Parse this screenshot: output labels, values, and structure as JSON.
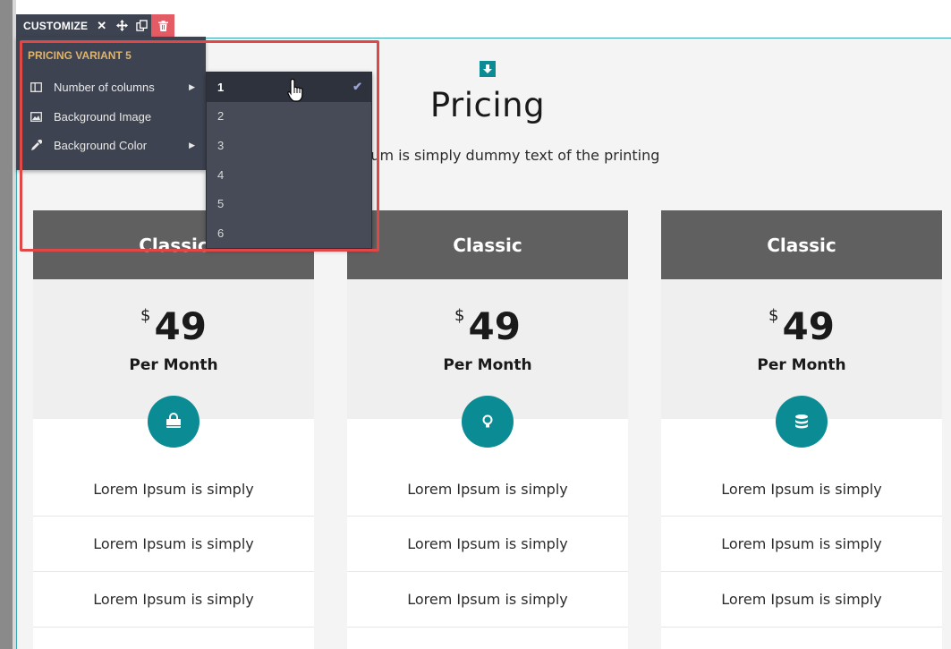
{
  "toolbar": {
    "customize_label": "CUSTOMIZE",
    "close_symbol": "✕",
    "icons": [
      "move-icon",
      "duplicate-icon",
      "trash-icon"
    ]
  },
  "menu": {
    "header": "PRICING VARIANT 5",
    "items": [
      {
        "label": "Number of columns",
        "icon": "columns-icon",
        "has_submenu": true
      },
      {
        "label": "Background Image",
        "icon": "image-icon",
        "has_submenu": false
      },
      {
        "label": "Background Color",
        "icon": "eyedropper-icon",
        "has_submenu": true
      }
    ]
  },
  "columns_submenu": {
    "options": [
      "1",
      "2",
      "3",
      "4",
      "5",
      "6"
    ],
    "selected": "1"
  },
  "section": {
    "title": "Pricing",
    "subtitle": "sum is simply dummy text of the printing"
  },
  "plans": [
    {
      "name": "Classic",
      "currency": "$",
      "price": "49",
      "period": "Per Month",
      "icon": "shopping-bag-icon",
      "features": [
        "Lorem Ipsum is simply",
        "Lorem Ipsum is simply",
        "Lorem Ipsum is simply"
      ]
    },
    {
      "name": "Classic",
      "currency": "$",
      "price": "49",
      "period": "Per Month",
      "icon": "lightbulb-icon",
      "features": [
        "Lorem Ipsum is simply",
        "Lorem Ipsum is simply",
        "Lorem Ipsum is simply"
      ]
    },
    {
      "name": "Classic",
      "currency": "$",
      "price": "49",
      "period": "Per Month",
      "icon": "database-icon",
      "features": [
        "Lorem Ipsum is simply",
        "Lorem Ipsum is simply",
        "Lorem Ipsum is simply"
      ]
    }
  ],
  "colors": {
    "accent": "#0b8c94",
    "toolbar_bg": "#3d4350",
    "delete_btn": "#e35b65",
    "menu_header": "#e0b46b",
    "highlight": "#e04848",
    "card_header": "#606060"
  }
}
